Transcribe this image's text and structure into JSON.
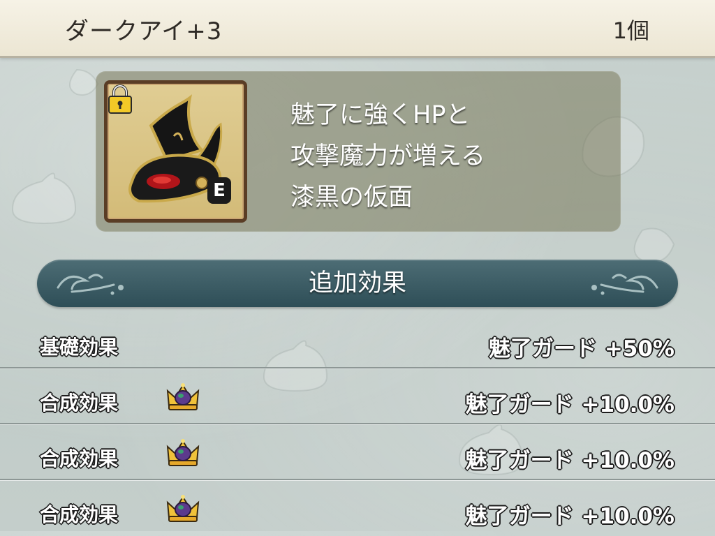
{
  "header": {
    "item_name": "ダークアイ+3",
    "item_count": "1個"
  },
  "item_card": {
    "icon": "dark-eye-mask-icon",
    "locked_icon": "padlock-icon",
    "equipped_badge": "E",
    "description_lines": [
      "魅了に強くHPと",
      "攻撃魔力が増える",
      "漆黒の仮面"
    ]
  },
  "effects_section": {
    "title": "追加効果",
    "rows": [
      {
        "label": "基礎効果",
        "value": "魅了ガード +50%",
        "icon": null
      },
      {
        "label": "合成効果",
        "value": "魅了ガード +10.0%",
        "icon": "crown-icon"
      },
      {
        "label": "合成効果",
        "value": "魅了ガード +10.0%",
        "icon": "crown-icon"
      },
      {
        "label": "合成効果",
        "value": "魅了ガード +10.0%",
        "icon": "crown-icon"
      }
    ]
  },
  "colors": {
    "header_bg": "#f0ebdc",
    "section_header_bg": "#3b5b63",
    "panel_bg": "#8a8866",
    "icon_frame_bg": "#d8c384"
  }
}
